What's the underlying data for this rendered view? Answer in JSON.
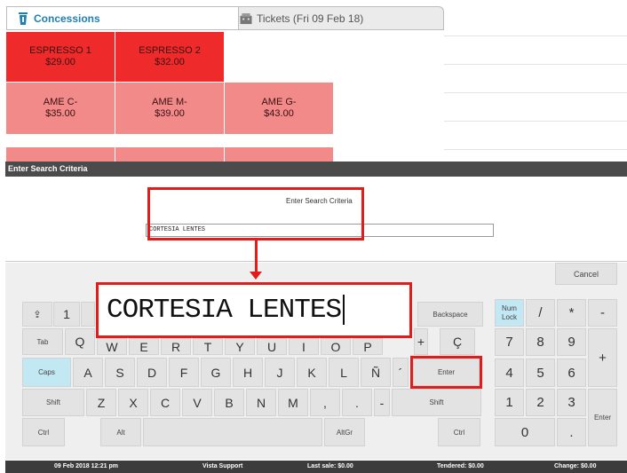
{
  "tabs": {
    "concessions": "Concessions",
    "tickets": "Tickets (Fri 09 Feb 18)"
  },
  "tiles": [
    {
      "name": "ESPRESSO 1",
      "price": "$29.00"
    },
    {
      "name": "ESPRESSO 2",
      "price": "$32.00"
    },
    {
      "name": "AME C-",
      "price": "$35.00"
    },
    {
      "name": "AME M-",
      "price": "$39.00"
    },
    {
      "name": "AME G-",
      "price": "$43.00"
    }
  ],
  "dialog": {
    "title": "Enter Search Criteria",
    "label": "Enter Search Criteria",
    "value": "CORTESIA LENTES",
    "cancel": "Cancel"
  },
  "keys": {
    "row1": [
      "⇪",
      "1",
      "Backspace"
    ],
    "row2": [
      "Tab",
      "Q",
      "W",
      "E",
      "R",
      "T",
      "Y",
      "U",
      "I",
      "O",
      "P",
      "+",
      "Ç"
    ],
    "row3": [
      "Caps",
      "A",
      "S",
      "D",
      "F",
      "G",
      "H",
      "J",
      "K",
      "L",
      "Ñ",
      "´",
      "Enter"
    ],
    "row4": [
      "Shift",
      "Z",
      "X",
      "C",
      "V",
      "B",
      "N",
      "M",
      ",",
      ".",
      "-",
      "Shift"
    ],
    "row5": [
      "Ctrl",
      "Alt",
      "AltGr",
      "Ctrl"
    ]
  },
  "numpad": {
    "numlock": "Num Lock",
    "keys": [
      "/",
      "*",
      "-",
      "7",
      "8",
      "9",
      "+",
      "4",
      "5",
      "6",
      "1",
      "2",
      "3",
      "Enter",
      "0",
      "."
    ]
  },
  "status": {
    "datetime": "09 Feb 2018 12:21 pm",
    "support": "Vista Support",
    "last_sale": "Last sale: $0.00",
    "tendered": "Tendered: $0.00",
    "change": "Change: $0.00"
  },
  "colors": {
    "tile_dark": "#ee2a2a",
    "tile_light": "#f28a8a",
    "highlight": "#e21b1b",
    "key_blue": "#c2e8f3",
    "tab_active": "#1e7fb0"
  },
  "icons": {
    "concessions": "cup-icon",
    "tickets": "ticket-icon"
  }
}
